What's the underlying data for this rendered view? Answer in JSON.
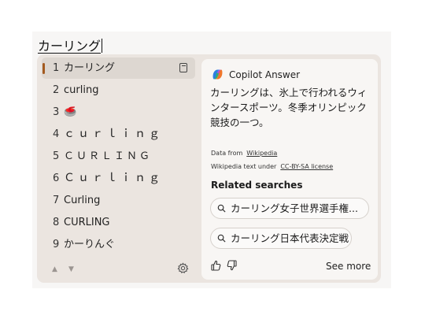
{
  "composition": {
    "text": "カーリング"
  },
  "candidates": [
    {
      "num": "1",
      "text": "カーリング"
    },
    {
      "num": "2",
      "text": "curling"
    },
    {
      "num": "3",
      "text": "🥌"
    },
    {
      "num": "4",
      "text": "ｃｕｒｌｉｎｇ"
    },
    {
      "num": "5",
      "text": "ＣＵＲＬＩＮＧ"
    },
    {
      "num": "6",
      "text": "Ｃｕｒｌｉｎｇ"
    },
    {
      "num": "7",
      "text": "Curling"
    },
    {
      "num": "8",
      "text": "CURLING"
    },
    {
      "num": "9",
      "text": "かーりんぐ"
    }
  ],
  "selected_index": 0,
  "icons": {
    "selected_doc": "document-icon",
    "prev": "triangle-up-icon",
    "next": "triangle-down-icon",
    "settings": "gear-icon",
    "copilot": "copilot-logo-icon",
    "search": "search-icon",
    "like": "thumbs-up-icon",
    "dislike": "thumbs-down-icon"
  },
  "copilot": {
    "title": "Copilot Answer",
    "answer": "カーリングは、氷上で行われるウィンタースポーツ。冬季オリンピック競技の一つ。",
    "source_label": "Data from",
    "source_link": "Wikipedia",
    "license_label": "Wikipedia text under",
    "license_link": "CC-BY-SA license",
    "related_title": "Related searches",
    "related": [
      "カーリング女子世界選手権...",
      "カーリング日本代表決定戦"
    ],
    "see_more": "See more"
  },
  "colors": {
    "selection_accent": "#a35a1f",
    "window_bg": "#ebe5e0",
    "panel_bg": "#f8f6f4"
  }
}
